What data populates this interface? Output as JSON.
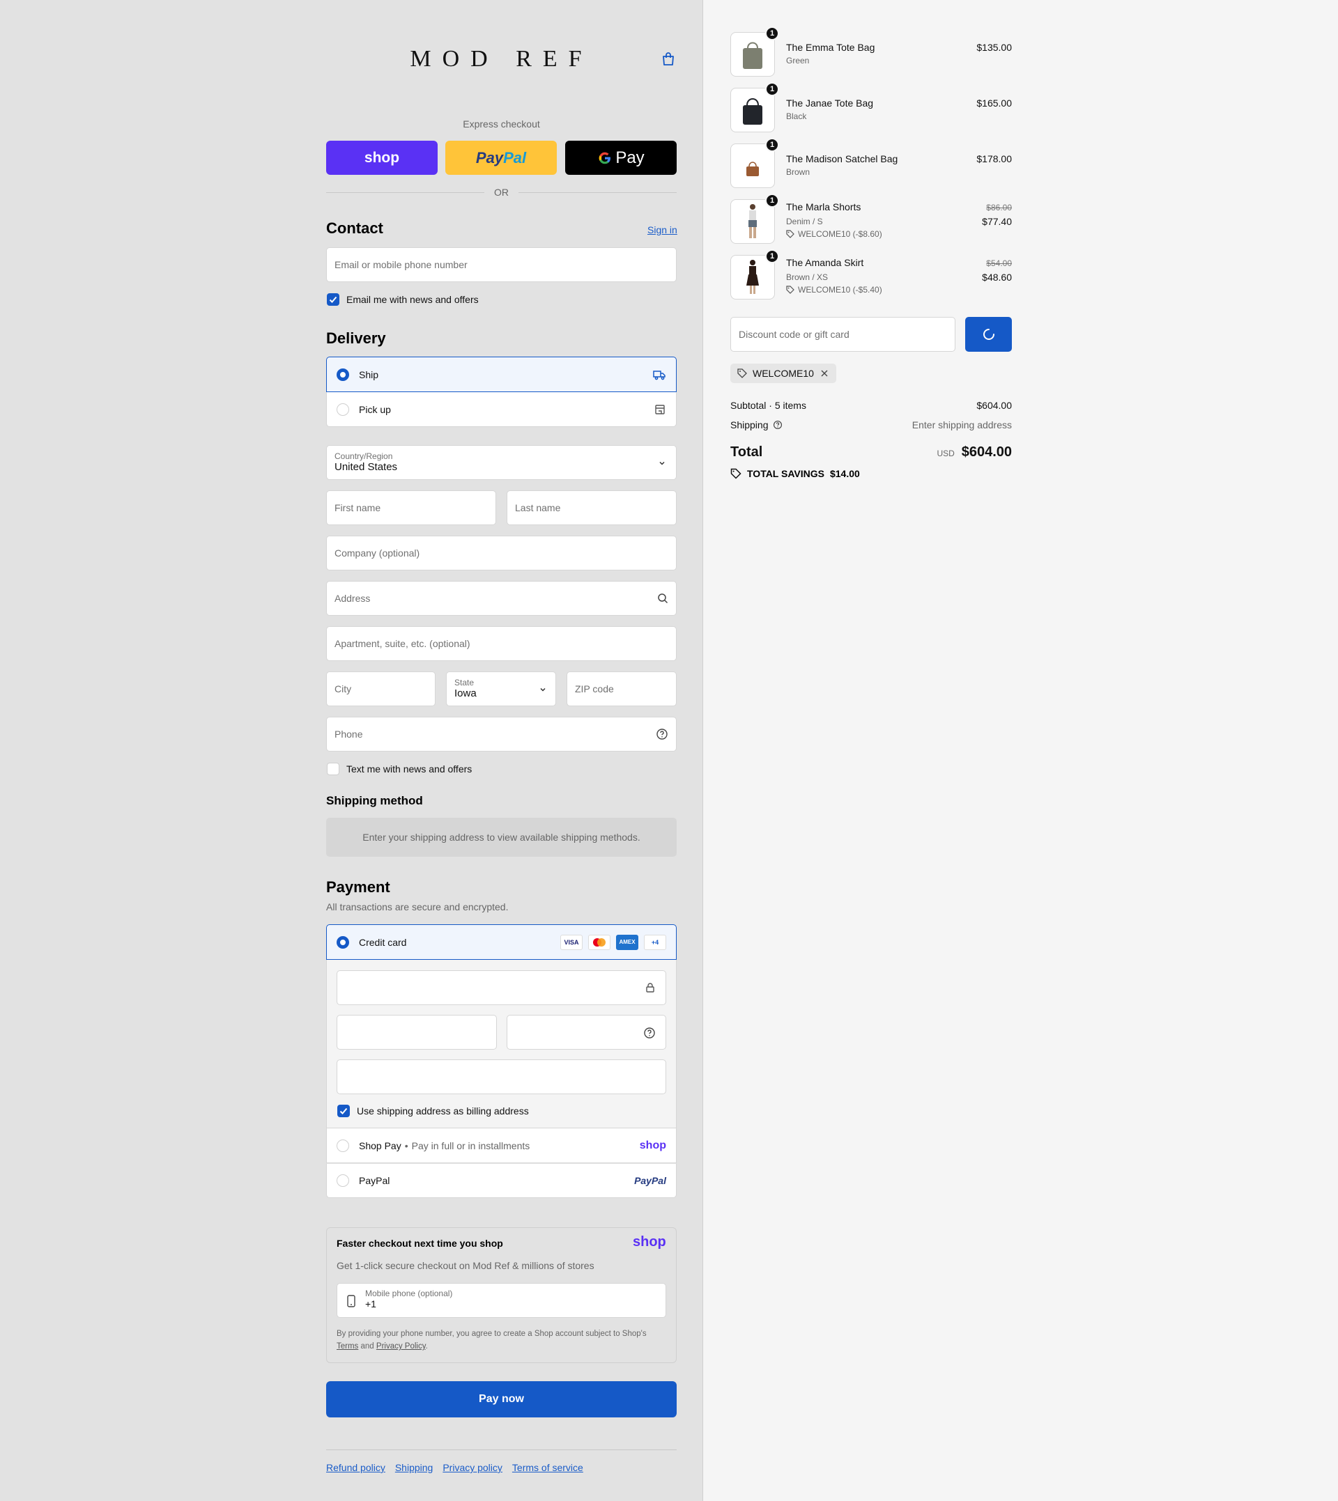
{
  "brand": {
    "logo_text": "MOD REF"
  },
  "express": {
    "label": "Express checkout",
    "shop_label": "shop",
    "paypal_label": "PayPal",
    "gpay_label": "Pay",
    "or_label": "OR"
  },
  "contact": {
    "title": "Contact",
    "signin_label": "Sign in",
    "email_placeholder": "Email or mobile phone number",
    "news_label": "Email me with news and offers",
    "news_checked": true
  },
  "delivery": {
    "title": "Delivery",
    "options": [
      {
        "label": "Ship",
        "selected": true,
        "icon": "truck-icon"
      },
      {
        "label": "Pick up",
        "selected": false,
        "icon": "store-icon"
      }
    ],
    "country_label": "Country/Region",
    "country_value": "United States",
    "first_name_placeholder": "First name",
    "last_name_placeholder": "Last name",
    "company_placeholder": "Company (optional)",
    "address_placeholder": "Address",
    "apartment_placeholder": "Apartment, suite, etc. (optional)",
    "city_placeholder": "City",
    "state_label": "State",
    "state_value": "Iowa",
    "zip_placeholder": "ZIP code",
    "phone_placeholder": "Phone",
    "text_news_label": "Text me with news and offers",
    "text_news_checked": false
  },
  "shipping_method": {
    "title": "Shipping method",
    "notice": "Enter your shipping address to view available shipping methods."
  },
  "payment": {
    "title": "Payment",
    "subtitle": "All transactions are secure and encrypted.",
    "credit_card_label": "Credit card",
    "card_badges": [
      "VISA",
      "MC",
      "AMEX",
      "+4"
    ],
    "billing_label": "Use shipping address as billing address",
    "billing_checked": true,
    "shoppay_label": "Shop Pay",
    "shoppay_sub": "Pay in full or in installments",
    "shoppay_logo": "shop",
    "paypal_label": "PayPal",
    "paypal_logo": "PayPal"
  },
  "shop_promo": {
    "title": "Faster checkout next time you shop",
    "logo": "shop",
    "subtitle": "Get 1-click secure checkout on Mod Ref & millions of stores",
    "phone_label": "Mobile phone (optional)",
    "phone_value": "+1",
    "legal_prefix": "By providing your phone number, you agree to create a Shop account subject to Shop's",
    "terms_label": "Terms",
    "and_label": "and",
    "privacy_label": "Privacy Policy",
    "period": "."
  },
  "pay_now_label": "Pay now",
  "footer_links": [
    "Refund policy",
    "Shipping",
    "Privacy policy",
    "Terms of service"
  ],
  "cart": {
    "items": [
      {
        "name": "The Emma Tote Bag",
        "variant": "Green",
        "qty": "1",
        "price": "$135.00",
        "color": "#7c7f70"
      },
      {
        "name": "The Janae Tote Bag",
        "variant": "Black",
        "qty": "1",
        "price": "$165.00",
        "color": "#22252b"
      },
      {
        "name": "The Madison Satchel Bag",
        "variant": "Brown",
        "qty": "1",
        "price": "$178.00",
        "color": "#9a5a32"
      },
      {
        "name": "The Marla Shorts",
        "variant": "Denim / S",
        "qty": "1",
        "orig_price": "$86.00",
        "price": "$77.40",
        "discount": "WELCOME10 (-$8.60)",
        "color": "#5e6d7c"
      },
      {
        "name": "The Amanda Skirt",
        "variant": "Brown / XS",
        "qty": "1",
        "orig_price": "$54.00",
        "price": "$48.60",
        "discount": "WELCOME10 (-$5.40)",
        "color": "#2a1a14"
      }
    ],
    "discount_placeholder": "Discount code or gift card",
    "applied_code": "WELCOME10",
    "subtotal_label": "Subtotal · 5 items",
    "subtotal_value": "$604.00",
    "shipping_label": "Shipping",
    "shipping_value": "Enter shipping address",
    "total_label": "Total",
    "total_currency": "USD",
    "total_value": "$604.00",
    "savings_label": "TOTAL SAVINGS",
    "savings_value": "$14.00"
  },
  "colors": {
    "accent": "#1559c7",
    "shop_purple": "#5a31f4",
    "paypal_yellow": "#ffc439"
  }
}
